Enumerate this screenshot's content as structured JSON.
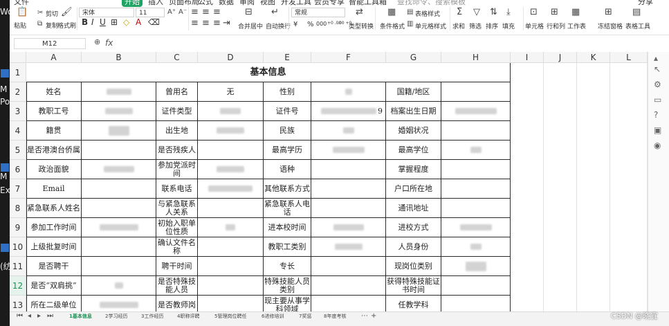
{
  "desktop_fragments": [
    "Wo",
    "M",
    "Po",
    "M",
    "Ex",
    "(纺"
  ],
  "ribbon": {
    "top_tabs": [
      "文件",
      "开始",
      "插入",
      "页面布局",
      "公式",
      "数据",
      "审阅",
      "视图",
      "开发工具",
      "会员专享",
      "智能工具箱"
    ],
    "active_tab": "开始",
    "search_hint": "查找命令、搜索模板",
    "share": "分享",
    "paste": "粘贴",
    "cut": "剪切",
    "copy": "复制",
    "format_painter": "格式刷",
    "font_name": "宋体",
    "font_size": "11",
    "merge_center": "合并居中",
    "wrap_text": "自动换行",
    "number_format": "常规",
    "currency_symbol": "¥",
    "percent_symbol": "%",
    "thousands_sep": "000",
    "inc_decimal": "+0 .00",
    "dec_decimal": ".00 +0",
    "type_convert": "类型转换",
    "cond_format": "条件格式",
    "table_style": "表格样式",
    "cell_style": "单元格样式",
    "sum": "求和",
    "filter": "筛选",
    "sort": "排序",
    "fill": "填充",
    "cells": "单元格",
    "row_col": "行和列",
    "worksheet": "工作表",
    "freeze": "冻结窗格",
    "table_tools": "表格工具"
  },
  "formula_bar": {
    "cell_ref": "M12",
    "fx": "fx"
  },
  "columns": [
    "A",
    "B",
    "C",
    "D",
    "E",
    "F",
    "G",
    "H",
    "I",
    "J",
    "K",
    "L"
  ],
  "rows": [
    "1",
    "2",
    "3",
    "4",
    "5",
    "6",
    "7",
    "8",
    "9",
    "10",
    "11",
    "12",
    "13"
  ],
  "selected_row": "12",
  "sheet": {
    "title": "基本信息",
    "r2": {
      "a": "姓名",
      "c": "曾用名",
      "d": "无",
      "e": "性别",
      "g": "国籍/地区"
    },
    "r3": {
      "a": "教职工号",
      "c": "证件类型",
      "e": "证件号",
      "f_tail": "9",
      "g": "档案出生日期"
    },
    "r4": {
      "a": "籍贯",
      "c": "出生地",
      "e": "民族",
      "g": "婚姻状况"
    },
    "r5": {
      "a": "是否港澳台侨属",
      "c": "是否残疾人",
      "e": "最高学历",
      "g": "最高学位"
    },
    "r6": {
      "a": "政治面貌",
      "c": "参加党派时间",
      "e": "语种",
      "g": "掌握程度"
    },
    "r7": {
      "a": "Email",
      "c": "联系电话",
      "e": "其他联系方式",
      "g": "户口所在地"
    },
    "r8": {
      "a": "紧急联系人姓名",
      "c": "与紧急联系人关系",
      "e": "紧急联系人电话",
      "g": "通讯地址"
    },
    "r9": {
      "a": "参加工作时间",
      "c": "初始入职单位性质",
      "e": "进本校时间",
      "g": "进校方式"
    },
    "r10": {
      "a": "上级批复时间",
      "c": "确认文件名称",
      "e": "教职工类别",
      "g": "人员身份"
    },
    "r11": {
      "a": "是否聘干",
      "c": "聘干时间",
      "e": "专长",
      "g": "现岗位类别"
    },
    "r12": {
      "a": "是否“双肩挑”",
      "c": "是否特殊技能人员",
      "e": "特殊技能人员类别",
      "g": "获得特殊技能证书时间"
    },
    "r13": {
      "a": "所在二级单位",
      "c": "是否教师岗",
      "e": "现主要从事学科领域",
      "g": "任教学科"
    }
  },
  "sheet_tabs": [
    "1基本信息",
    "2学习经历",
    "3工作经历",
    "4职称评聘",
    "5管理岗位聘任",
    "6进修培训",
    "7奖惩",
    "8年度考核"
  ],
  "active_sheet": "1基本信息",
  "watermark": "CSDN @晓宜"
}
